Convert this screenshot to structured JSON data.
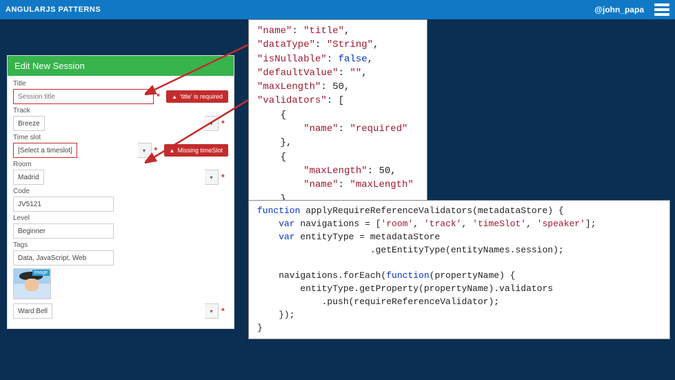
{
  "topbar": {
    "title": "ANGULARJS PATTERNS",
    "handle": "@john_papa"
  },
  "form": {
    "header": "Edit New Session",
    "title_label": "Title",
    "title_placeholder": "Session title",
    "title_error": "'title' is required",
    "track_label": "Track",
    "track_value": "Breeze",
    "timeslot_label": "Time slot",
    "timeslot_value": "[Select a timeslot]",
    "timeslot_error": "Missing timeSlot",
    "room_label": "Room",
    "room_value": "Madrid",
    "code_label": "Code",
    "code_value": "JV5121",
    "level_label": "Level",
    "level_value": "Beginner",
    "tags_label": "Tags",
    "tags_value": "Data, JavaScript, Web",
    "avatar_tag": "Image",
    "speaker_value": "Ward Bell"
  },
  "code_json": {
    "l1a": "\"name\"",
    "l1c": ": ",
    "l1b": "\"title\"",
    "l1e": ",",
    "l2a": "\"dataType\"",
    "l2c": ": ",
    "l2b": "\"String\"",
    "l2e": ",",
    "l3a": "\"isNullable\"",
    "l3c": ": ",
    "l3b": "false",
    "l3e": ",",
    "l4a": "\"defaultValue\"",
    "l4c": ": ",
    "l4b": "\"\"",
    "l4e": ",",
    "l5a": "\"maxLength\"",
    "l5c": ": ",
    "l5b": "50",
    "l5e": ",",
    "l6a": "\"validators\"",
    "l6c": ": ",
    "l6b": "[",
    "l7": "    {",
    "l8a": "        \"name\"",
    "l8c": ": ",
    "l8b": "\"required\"",
    "l9": "    },",
    "l10": "    {",
    "l11a": "        \"maxLength\"",
    "l11c": ": ",
    "l11b": "50",
    "l11e": ",",
    "l12a": "        \"name\"",
    "l12c": ": ",
    "l12b": "\"maxLength\"",
    "l13": "    }",
    "l14": "]"
  },
  "code_fn": {
    "l1a": "function",
    "l1b": " applyRequireReferenceValidators(metadataStore) {",
    "l2a": "    var",
    "l2b": " navigations = [",
    "l2c": "'room'",
    "l2d": ", ",
    "l2e": "'track'",
    "l2f": ", ",
    "l2g": "'timeSlot'",
    "l2h": ", ",
    "l2i": "'speaker'",
    "l2j": "];",
    "l3a": "    var",
    "l3b": " entityType = metadataStore",
    "l4": "                     .getEntityType(entityNames.session);",
    "l5": "",
    "l6a": "    navigations.forEach(",
    "l6b": "function",
    "l6c": "(propertyName) {",
    "l7": "        entityType.getProperty(propertyName).validators",
    "l8": "            .push(requireReferenceValidator);",
    "l9": "    });",
    "l10": "}"
  }
}
